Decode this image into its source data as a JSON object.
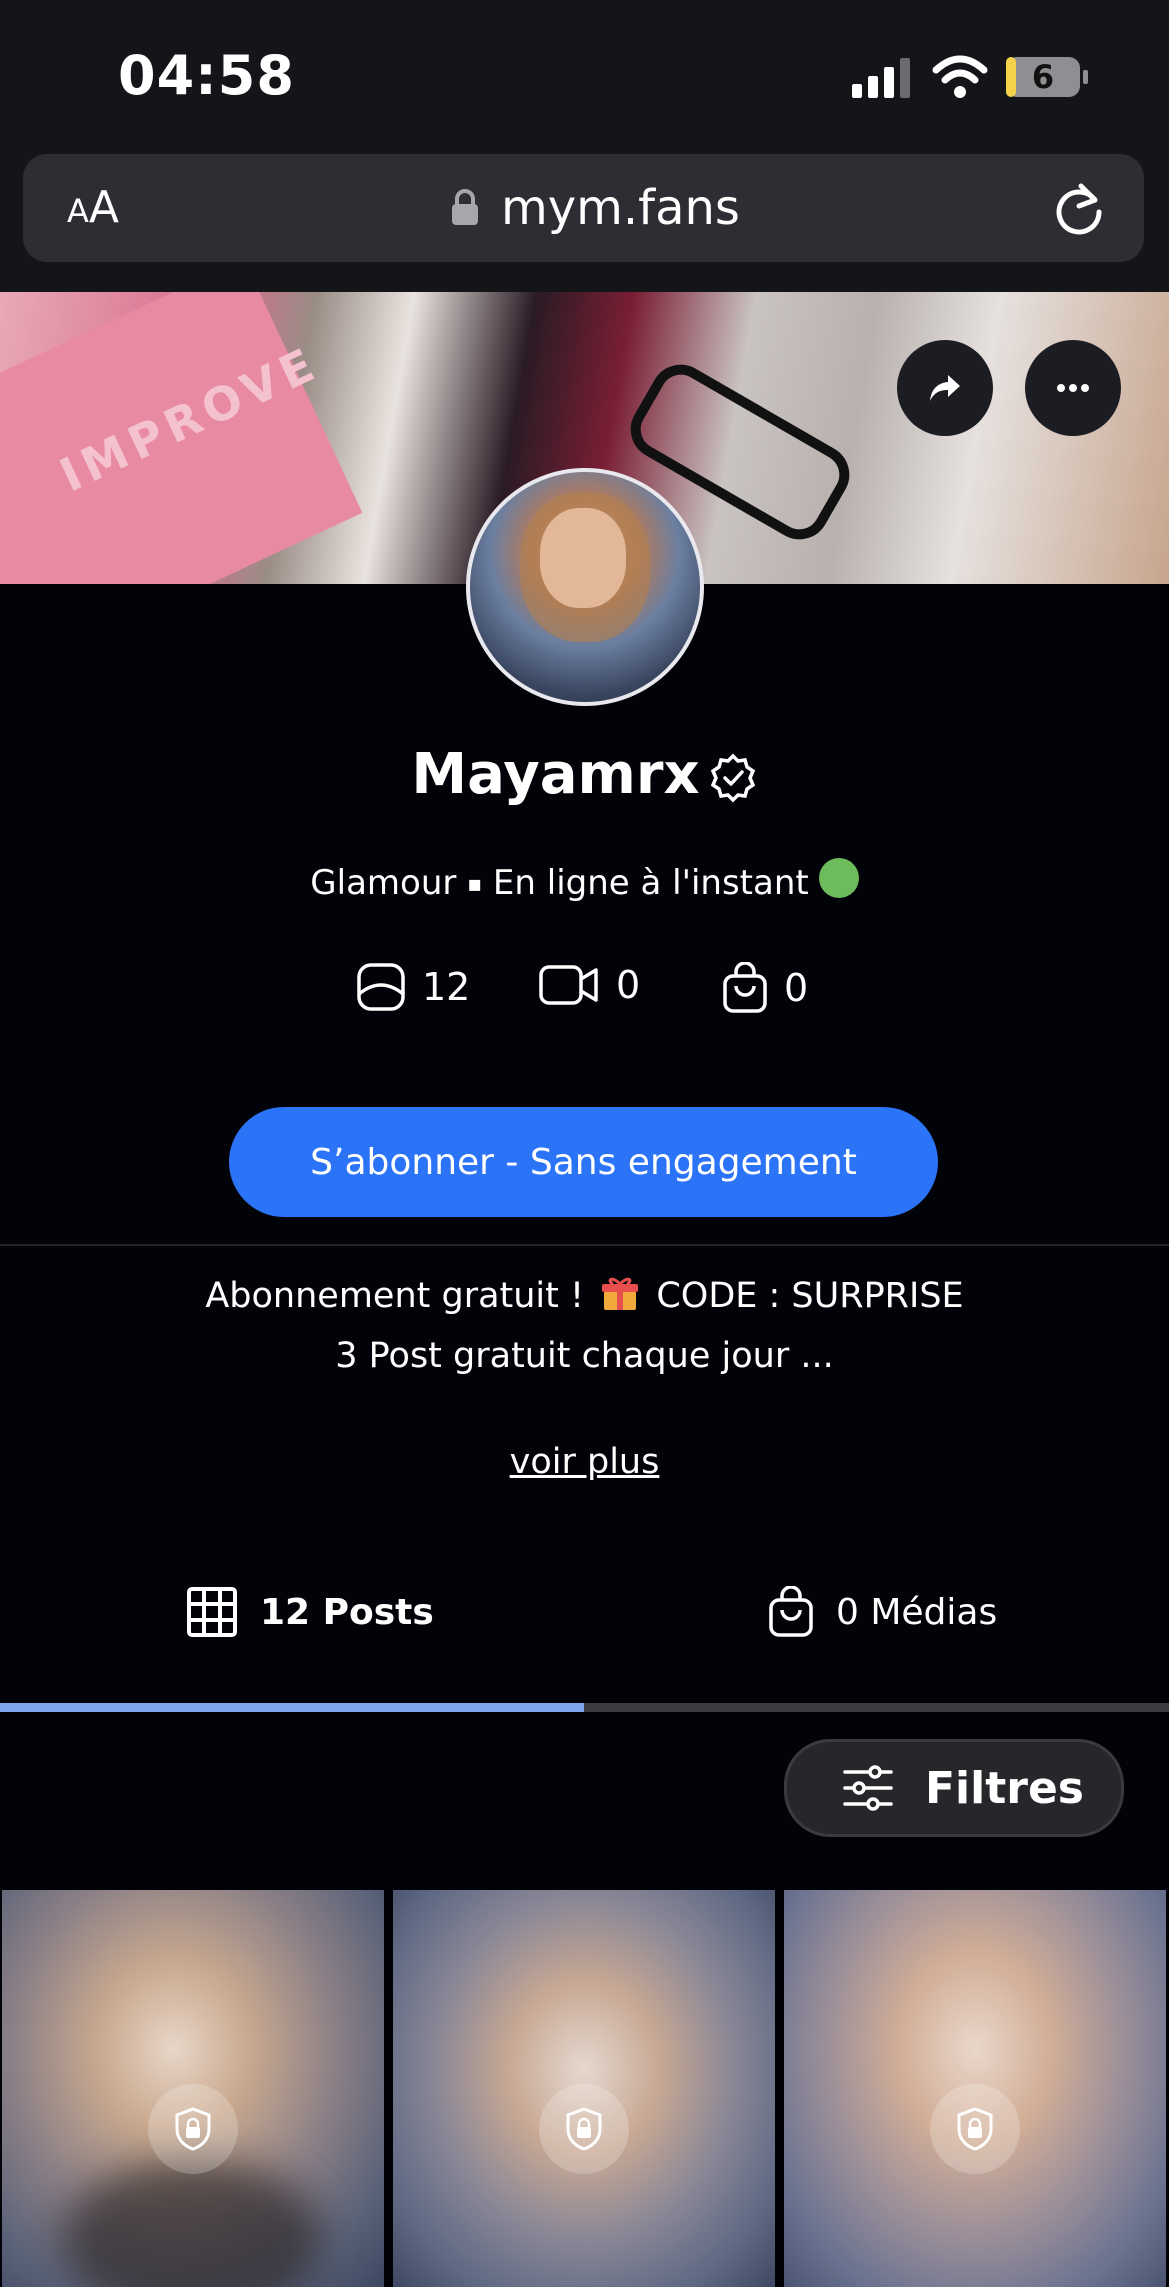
{
  "status_bar": {
    "time": "04:58",
    "battery": "6"
  },
  "browser": {
    "text_size_label_small": "A",
    "text_size_label_large": "A",
    "domain": "mym.fans"
  },
  "cover": {
    "book_text": "IMPROVE"
  },
  "profile": {
    "name": "Mayamrx",
    "category": "Glamour",
    "separator": "▪",
    "status": "En ligne à l'instant",
    "counts": {
      "photos": "12",
      "videos": "0",
      "products": "0"
    }
  },
  "subscribe_button": "S’abonner - Sans engagement",
  "bio": {
    "line1_before": "Abonnement gratuit !",
    "line1_after": "CODE : SURPRISE",
    "line2": "3 Post gratuit chaque jour ...",
    "more": "voir plus"
  },
  "tabs": [
    {
      "label": "12 Posts",
      "active": true
    },
    {
      "label": "0 Médias",
      "active": false
    }
  ],
  "filters_label": "Filtres",
  "colors": {
    "accent": "#2b73f7",
    "online": "#6dbb5a",
    "tab_indicator": "#7fa4ee",
    "background": "#020308"
  },
  "icons": [
    "lock-icon",
    "reload-icon",
    "share-icon",
    "more-icon",
    "verified-icon",
    "photo-icon",
    "video-icon",
    "bag-icon",
    "grid-icon",
    "filter-icon",
    "gift-icon"
  ]
}
